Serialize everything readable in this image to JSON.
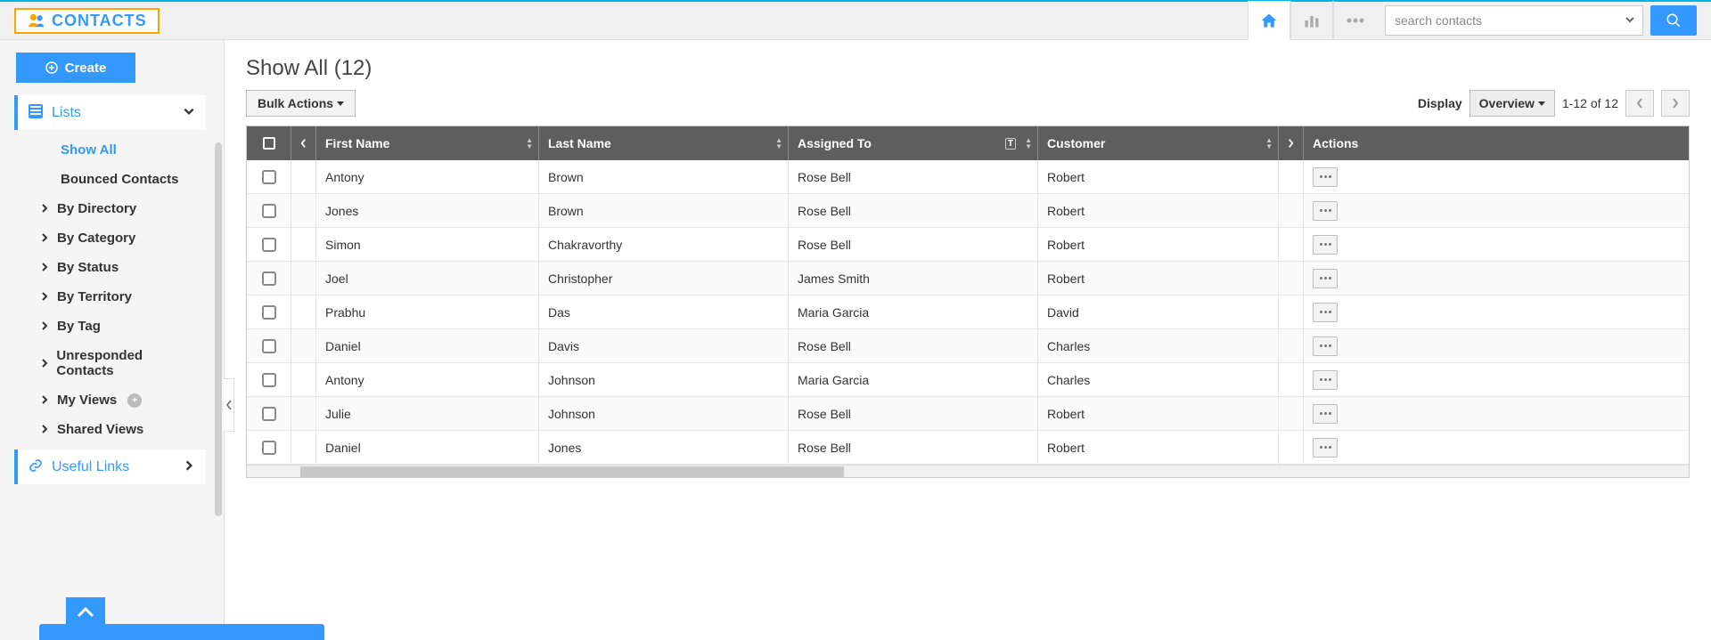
{
  "header": {
    "app_title": "CONTACTS",
    "search_placeholder": "search contacts"
  },
  "sidebar": {
    "create_label": "Create",
    "lists_label": "Lists",
    "useful_links_label": "Useful Links",
    "items": [
      {
        "label": "Show All",
        "indent": true,
        "active": true,
        "expandable": false
      },
      {
        "label": "Bounced Contacts",
        "indent": true,
        "active": false,
        "expandable": false
      },
      {
        "label": "By Directory",
        "indent": false,
        "expandable": true
      },
      {
        "label": "By Category",
        "indent": false,
        "expandable": true
      },
      {
        "label": "By Status",
        "indent": false,
        "expandable": true
      },
      {
        "label": "By Territory",
        "indent": false,
        "expandable": true
      },
      {
        "label": "By Tag",
        "indent": false,
        "expandable": true
      },
      {
        "label": "Unresponded Contacts",
        "indent": false,
        "expandable": true
      },
      {
        "label": "My Views",
        "indent": false,
        "expandable": true,
        "plus": true
      },
      {
        "label": "Shared Views",
        "indent": false,
        "expandable": true
      }
    ]
  },
  "main": {
    "title": "Show All (12)",
    "bulk_actions_label": "Bulk Actions",
    "display_label": "Display",
    "overview_label": "Overview",
    "page_info": "1-12 of 12",
    "columns": {
      "first_name": "First Name",
      "last_name": "Last Name",
      "assigned_to": "Assigned To",
      "customer": "Customer",
      "actions": "Actions"
    },
    "rows": [
      {
        "first": "Antony",
        "last": "Brown",
        "assigned": "Rose Bell",
        "customer": "Robert"
      },
      {
        "first": "Jones",
        "last": "Brown",
        "assigned": "Rose Bell",
        "customer": "Robert"
      },
      {
        "first": "Simon",
        "last": "Chakravorthy",
        "assigned": "Rose Bell",
        "customer": "Robert"
      },
      {
        "first": "Joel",
        "last": "Christopher",
        "assigned": "James Smith",
        "customer": "Robert"
      },
      {
        "first": "Prabhu",
        "last": "Das",
        "assigned": "Maria Garcia",
        "customer": "David"
      },
      {
        "first": "Daniel",
        "last": "Davis",
        "assigned": "Rose Bell",
        "customer": "Charles"
      },
      {
        "first": "Antony",
        "last": "Johnson",
        "assigned": "Maria Garcia",
        "customer": "Charles"
      },
      {
        "first": "Julie",
        "last": "Johnson",
        "assigned": "Rose Bell",
        "customer": "Robert"
      },
      {
        "first": "Daniel",
        "last": "Jones",
        "assigned": "Rose Bell",
        "customer": "Robert"
      }
    ]
  }
}
